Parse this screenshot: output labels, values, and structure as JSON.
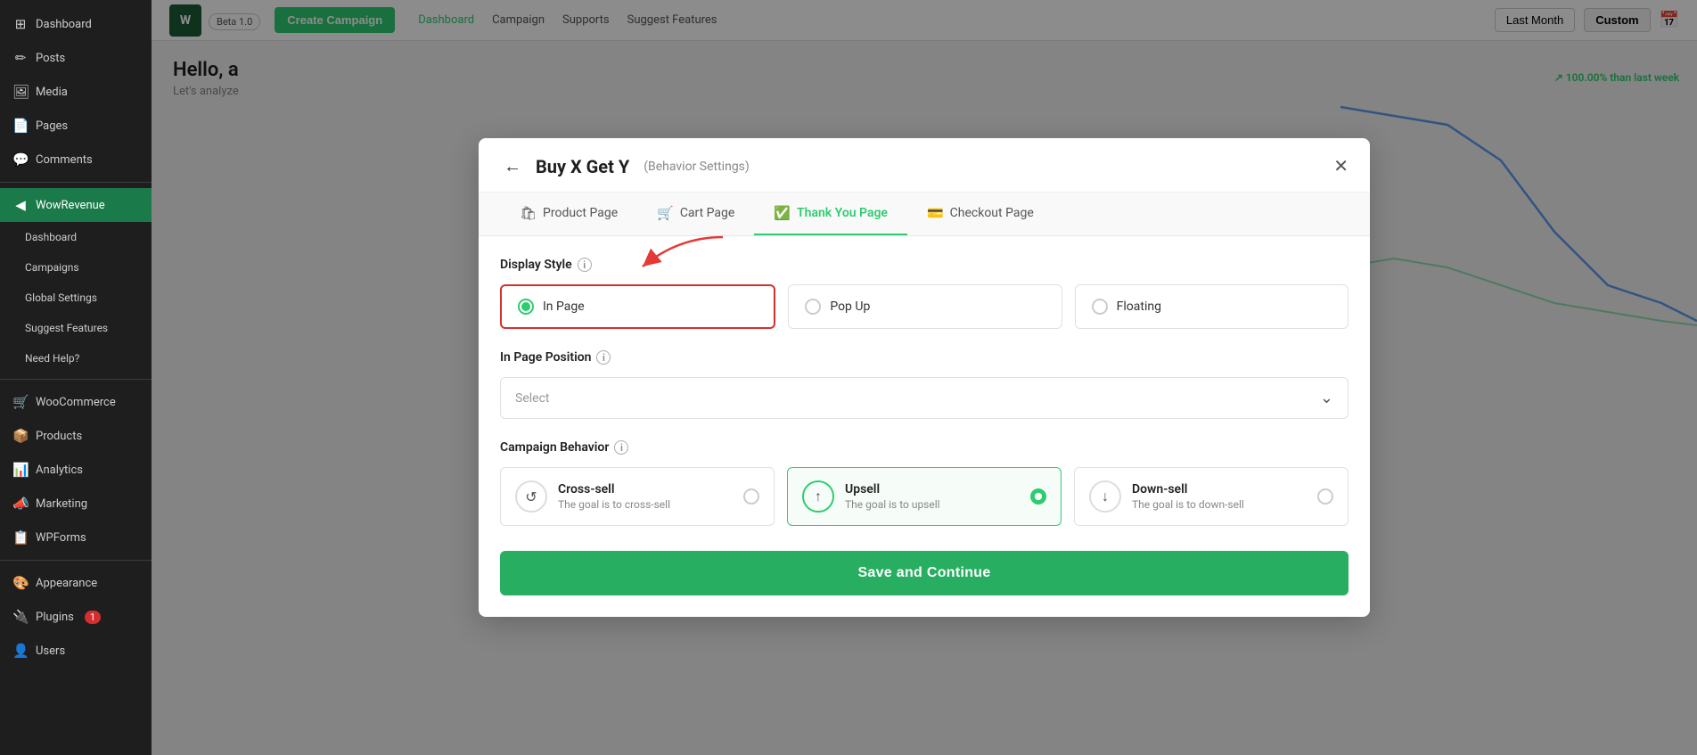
{
  "sidebar": {
    "items": [
      {
        "id": "dashboard-wp",
        "label": "Dashboard",
        "icon": "⊞",
        "active": false
      },
      {
        "id": "posts",
        "label": "Posts",
        "icon": "📝",
        "active": false
      },
      {
        "id": "media",
        "label": "Media",
        "icon": "🖼",
        "active": false
      },
      {
        "id": "pages",
        "label": "Pages",
        "icon": "📄",
        "active": false
      },
      {
        "id": "comments",
        "label": "Comments",
        "icon": "💬",
        "active": false
      },
      {
        "id": "wowrevenue",
        "label": "WowRevenue",
        "icon": "◀",
        "active": true
      },
      {
        "id": "dashboard-sub",
        "label": "Dashboard",
        "icon": "",
        "active": false
      },
      {
        "id": "campaigns",
        "label": "Campaigns",
        "icon": "",
        "active": false
      },
      {
        "id": "global-settings",
        "label": "Global Settings",
        "icon": "",
        "active": false
      },
      {
        "id": "suggest-features",
        "label": "Suggest Features",
        "icon": "",
        "active": false
      },
      {
        "id": "need-help",
        "label": "Need Help?",
        "icon": "",
        "active": false
      },
      {
        "id": "woocommerce",
        "label": "WooCommerce",
        "icon": "🛒",
        "active": false
      },
      {
        "id": "products",
        "label": "Products",
        "icon": "📦",
        "active": false
      },
      {
        "id": "analytics",
        "label": "Analytics",
        "icon": "📊",
        "active": false
      },
      {
        "id": "marketing",
        "label": "Marketing",
        "icon": "📣",
        "active": false
      },
      {
        "id": "wpforms",
        "label": "WPForms",
        "icon": "📋",
        "active": false
      },
      {
        "id": "appearance",
        "label": "Appearance",
        "icon": "🎨",
        "active": false
      },
      {
        "id": "plugins",
        "label": "Plugins",
        "icon": "🔌",
        "active": false,
        "badge": "1"
      },
      {
        "id": "users",
        "label": "Users",
        "icon": "👤",
        "active": false
      }
    ]
  },
  "topbar": {
    "beta_label": "Beta 1.0",
    "create_btn": "Create Campaign",
    "nav_items": [
      {
        "label": "Dashboard",
        "active": true
      },
      {
        "label": "Campaign",
        "active": false
      },
      {
        "label": "Supports",
        "active": false
      },
      {
        "label": "Suggest Features",
        "active": false
      }
    ],
    "date_filters": [
      {
        "label": "Last Month",
        "active": false
      },
      {
        "label": "Custom",
        "active": true
      }
    ]
  },
  "page": {
    "title": "Hello, a",
    "subtitle": "Let's analyze"
  },
  "modal": {
    "back_btn": "←",
    "title": "Buy X Get Y",
    "subtitle": "(Behavior Settings)",
    "close_btn": "✕",
    "tabs": [
      {
        "id": "product-page",
        "label": "Product Page",
        "icon": "🛍",
        "active": false
      },
      {
        "id": "cart-page",
        "label": "Cart Page",
        "icon": "🛒",
        "active": false
      },
      {
        "id": "thank-you-page",
        "label": "Thank You Page",
        "icon": "✅",
        "active": true
      },
      {
        "id": "checkout-page",
        "label": "Checkout Page",
        "icon": "💳",
        "active": false
      }
    ],
    "display_style": {
      "label": "Display Style",
      "options": [
        {
          "id": "in-page",
          "label": "In Page",
          "selected": true
        },
        {
          "id": "pop-up",
          "label": "Pop Up",
          "selected": false
        },
        {
          "id": "floating",
          "label": "Floating",
          "selected": false
        }
      ]
    },
    "in_page_position": {
      "label": "In Page Position",
      "placeholder": "Select"
    },
    "campaign_behavior": {
      "label": "Campaign Behavior",
      "options": [
        {
          "id": "cross-sell",
          "label": "Cross-sell",
          "desc": "The goal is to cross-sell",
          "selected": false
        },
        {
          "id": "upsell",
          "label": "Upsell",
          "desc": "The goal is to upsell",
          "selected": true
        },
        {
          "id": "down-sell",
          "label": "Down-sell",
          "desc": "The goal is to down-sell",
          "selected": false
        }
      ]
    },
    "save_btn": "Save and Continue",
    "percent_label": "100.00% than last week"
  }
}
